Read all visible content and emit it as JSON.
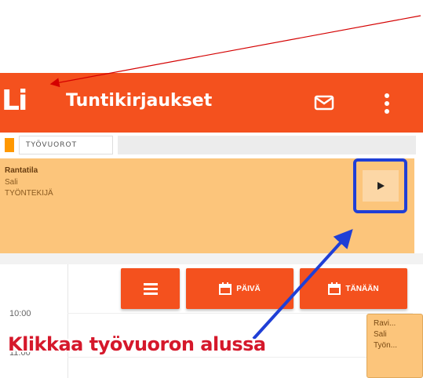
{
  "app": {
    "logo": "Li",
    "title": "Tuntikirjaukset",
    "icons": [
      "mail-icon",
      "more-vert-icon"
    ],
    "brand_color": "#f4511e"
  },
  "tabs": [
    {
      "label": "TYÖVUOROT",
      "indicator_color": "#ff9800"
    }
  ],
  "shift_card": {
    "title": "Rantatila",
    "line1": "Sali",
    "line2": "TYÖNTEKIJÄ",
    "background": "#fcc57b",
    "play_icon": "play-icon"
  },
  "toolbar": {
    "menu_icon": "hamburger-icon",
    "day_label": "PÄIVÄ",
    "today_label": "TÄNÄÄN",
    "calendar_icon": "calendar-icon"
  },
  "timeline": {
    "times": [
      "10:00",
      "11:00"
    ]
  },
  "event_chip": {
    "line1": "Ravi...",
    "line2": "Sali",
    "line3": "Työn..."
  },
  "annotation": {
    "caption": "Klikkaa työvuoron alussa",
    "caption_color": "#d5182b",
    "arrow_red": "#d40000",
    "arrow_blue": "#1f3fd6"
  }
}
